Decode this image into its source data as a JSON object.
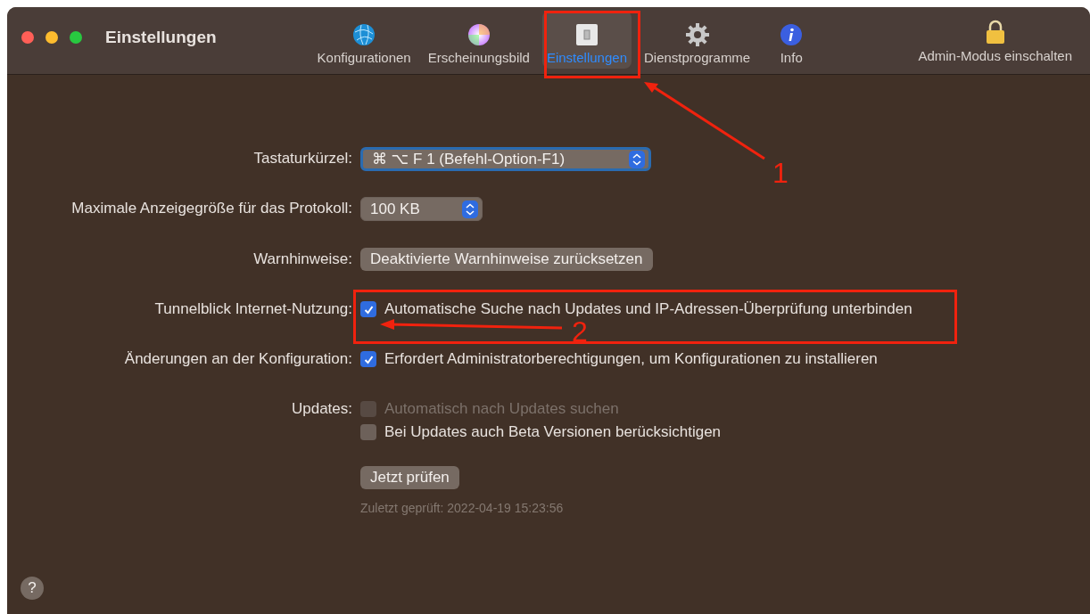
{
  "window": {
    "title": "Einstellungen"
  },
  "toolbar": [
    {
      "kind": "globe",
      "label": "Konfigurationen",
      "selected": false
    },
    {
      "kind": "colors",
      "label": "Erscheinungsbild",
      "selected": false
    },
    {
      "kind": "switch",
      "label": "Einstellungen",
      "selected": true
    },
    {
      "kind": "gear",
      "label": "Dienstprogramme",
      "selected": false
    },
    {
      "kind": "info",
      "label": "Info",
      "selected": false
    }
  ],
  "admin": {
    "label": "Admin-Modus einschalten"
  },
  "rows": [
    {
      "label": "Tastaturkürzel:",
      "kind": "popup",
      "value": "⌘ ⌥ F 1 (Befehl-Option-F1)",
      "focused": true
    },
    {
      "label": "Maximale Anzeigegröße für das Protokoll:",
      "kind": "popup",
      "value": "100 KB",
      "focused": false
    },
    {
      "label": "Warnhinweise:",
      "kind": "button",
      "value": "Deaktivierte Warnhinweise zurücksetzen"
    },
    {
      "label": "Tunnelblick Internet-Nutzung:",
      "kind": "checks",
      "checks": [
        {
          "text": "Automatische Suche nach Updates und IP-Adressen-Überprüfung unterbinden",
          "checked": true,
          "disabled": false
        }
      ]
    },
    {
      "label": "Änderungen an der Konfiguration:",
      "kind": "checks",
      "checks": [
        {
          "text": "Erfordert Administratorberechtigungen, um Konfigurationen zu installieren",
          "checked": true,
          "disabled": false
        }
      ]
    },
    {
      "label": "Updates:",
      "kind": "checks",
      "checks": [
        {
          "text": "Automatisch nach Updates suchen",
          "checked": false,
          "disabled": true
        },
        {
          "text": "Bei Updates auch Beta Versionen berücksichtigen",
          "checked": false,
          "disabled": false
        }
      ]
    }
  ],
  "check_button": {
    "label": "Jetzt prüfen"
  },
  "last_checked": "Zuletzt geprüft: 2022-04-19 15:23:56",
  "help": {
    "label": "?"
  },
  "annotations": [
    {
      "number": "1"
    },
    {
      "number": "2"
    }
  ]
}
